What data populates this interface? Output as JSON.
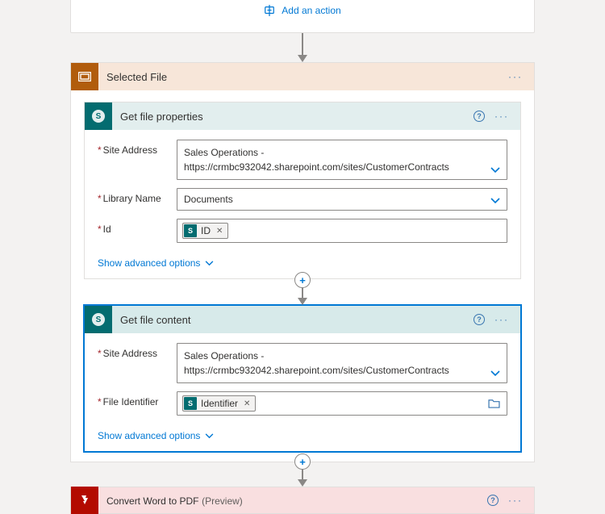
{
  "top": {
    "add_action": "Add an action"
  },
  "scope": {
    "title": "Selected File"
  },
  "action1": {
    "title": "Get file properties",
    "site_label": "Site Address",
    "site_value_line1": "Sales Operations -",
    "site_value_line2": "https://crmbc932042.sharepoint.com/sites/CustomerContracts",
    "lib_label": "Library Name",
    "lib_value": "Documents",
    "id_label": "Id",
    "id_token": "ID",
    "advanced": "Show advanced options"
  },
  "action2": {
    "title": "Get file content",
    "site_label": "Site Address",
    "site_value_line1": "Sales Operations -",
    "site_value_line2": "https://crmbc932042.sharepoint.com/sites/CustomerContracts",
    "fileid_label": "File Identifier",
    "fileid_token": "Identifier",
    "advanced": "Show advanced options"
  },
  "action3": {
    "title": "Convert Word to PDF",
    "preview": "(Preview)"
  }
}
